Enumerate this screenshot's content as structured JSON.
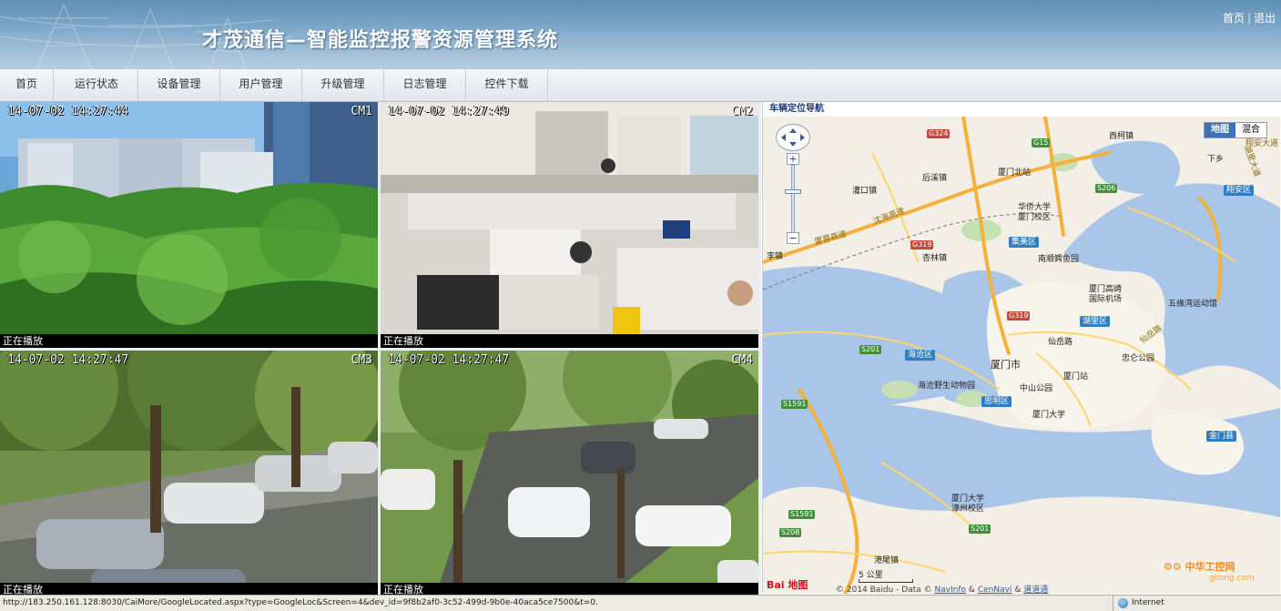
{
  "header": {
    "title": "才茂通信—智能监控报警资源管理系统",
    "links": {
      "home": "首页",
      "separator": "|",
      "logout": "退出"
    }
  },
  "nav": [
    {
      "label": "首页"
    },
    {
      "label": "运行状态"
    },
    {
      "label": "设备管理"
    },
    {
      "label": "用户管理"
    },
    {
      "label": "升级管理"
    },
    {
      "label": "日志管理"
    },
    {
      "label": "控件下载"
    }
  ],
  "cameras": [
    {
      "timestamp": "14-07-02 14:27:44",
      "id": "CM1",
      "status": "正在播放",
      "scene": "trees and high-rise buildings"
    },
    {
      "timestamp": "14-07-02 14:27:49",
      "id": "CM2",
      "status": "正在播放",
      "scene": "office with cubicles"
    },
    {
      "timestamp": "14-07-02 14:27:47",
      "id": "CM3",
      "status": "正在播放",
      "scene": "parking lot under trees"
    },
    {
      "timestamp": "14-07-02 14:27:47",
      "id": "CM4",
      "status": "正在播放",
      "scene": "parking lot with cars"
    }
  ],
  "map": {
    "title": "车辆定位导航",
    "type_buttons": {
      "map": "地图",
      "hybrid": "混合"
    },
    "zoom_in": "+",
    "zoom_out": "−",
    "places": [
      "西柯镇",
      "下乡",
      "厦门北站",
      "后溪镇",
      "灌口镇",
      "华侨大学",
      "厦门校区",
      "翔安区",
      "杏林镇",
      "集美区",
      "南顺鳄鱼园",
      "厦门高崎",
      "国际机场",
      "五缘湾运动馆",
      "湖里区",
      "仙岳路",
      "海沧区",
      "厦门市",
      "忠仑公园",
      "海沧野生动物园",
      "厦门站",
      "中山公园",
      "思明区",
      "厦门大学",
      "金门县",
      "厦门大学",
      "漳州校区",
      "港尾镇",
      "李镇",
      "沈海高速",
      "厦蓉高速",
      "湖里大道",
      "仙岳路"
    ],
    "roads": [
      "G324",
      "G15",
      "S206",
      "G319",
      "G319",
      "S201",
      "S1591",
      "S1591",
      "S208",
      "S201",
      "翔安大道"
    ],
    "scale_text": "5 公里",
    "baidu_logo": "Bai 地图",
    "copyright": "© 2014 Baidu - Data ©",
    "copyright_links": [
      "NavInfo",
      "&",
      "CenNavi",
      "&",
      "道道通"
    ],
    "watermark": "中华工控网",
    "watermark_sub": "gkong.com"
  },
  "statusbar": {
    "url": "http://183.250.161.128:8030/CaiMore/GoogleLocated.aspx?type=GoogleLoc&Screen=4&dev_id=9f8b2af0-3c52-499d-9b0e-40aca5ce7500&t=0.",
    "zone": "Internet"
  },
  "colors": {
    "accent": "#3f72b5",
    "header": "#7aa4c6",
    "water": "#a9c6e8",
    "land": "#f3efe6"
  }
}
